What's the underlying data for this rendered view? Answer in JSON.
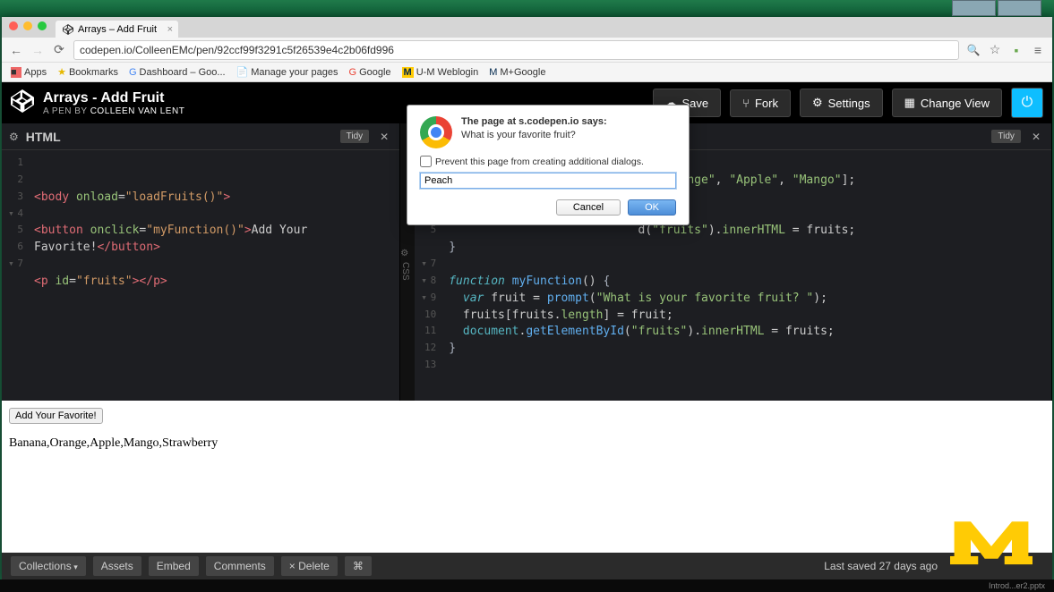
{
  "tab": {
    "title": "Arrays – Add Fruit"
  },
  "url": "codepen.io/ColleenEMc/pen/92ccf99f3291c5f26539e4c2b06fd996",
  "bookmarks": [
    "Apps",
    "Bookmarks",
    "Dashboard – Goo...",
    "Manage your pages",
    "Google",
    "U-M Weblogin",
    "M+Google"
  ],
  "header": {
    "title": "Arrays - Add Fruit",
    "byline_prefix": "A PEN BY",
    "author": "Colleen van Lent",
    "save": "Save",
    "fork": "Fork",
    "settings": "Settings",
    "changeview": "Change View"
  },
  "panel_html": {
    "title": "HTML",
    "tidy": "Tidy"
  },
  "panel_js": {
    "tidy": "Tidy"
  },
  "html_code": {
    "l2": "<body onload=\"loadFruits()\">",
    "l4": "<button onclick=\"myFunction()\">Add Your",
    "l5": "Favorite!</button>",
    "l7": "<p id=\"fruits\"></p>"
  },
  "js_code": {
    "l2_tail": "Orange\", \"Apple\", \"Mango\"];",
    "l4_tail": "d(\"fruits\").innerHTML = fruits;",
    "l5": "}",
    "l7": "function myFunction() {",
    "l8": "  var fruit = prompt(\"What is your favorite fruit? \");",
    "l9": "  fruits[fruits.length] = fruit;",
    "l10": "  document.getElementById(\"fruits\").innerHTML = fruits;",
    "l11": "}"
  },
  "dialog": {
    "title": "The page at s.codepen.io says:",
    "message": "What is your favorite fruit?",
    "prevent": "Prevent this page from creating additional dialogs.",
    "input_value": "Peach",
    "cancel": "Cancel",
    "ok": "OK"
  },
  "output": {
    "button": "Add Your Favorite!",
    "text": "Banana,Orange,Apple,Mango,Strawberry"
  },
  "footer": {
    "collections": "Collections",
    "assets": "Assets",
    "embed": "Embed",
    "comments": "Comments",
    "delete": "× Delete",
    "saved": "Last saved 27 days ago"
  },
  "taskbar": "Introd...er2.pptx"
}
